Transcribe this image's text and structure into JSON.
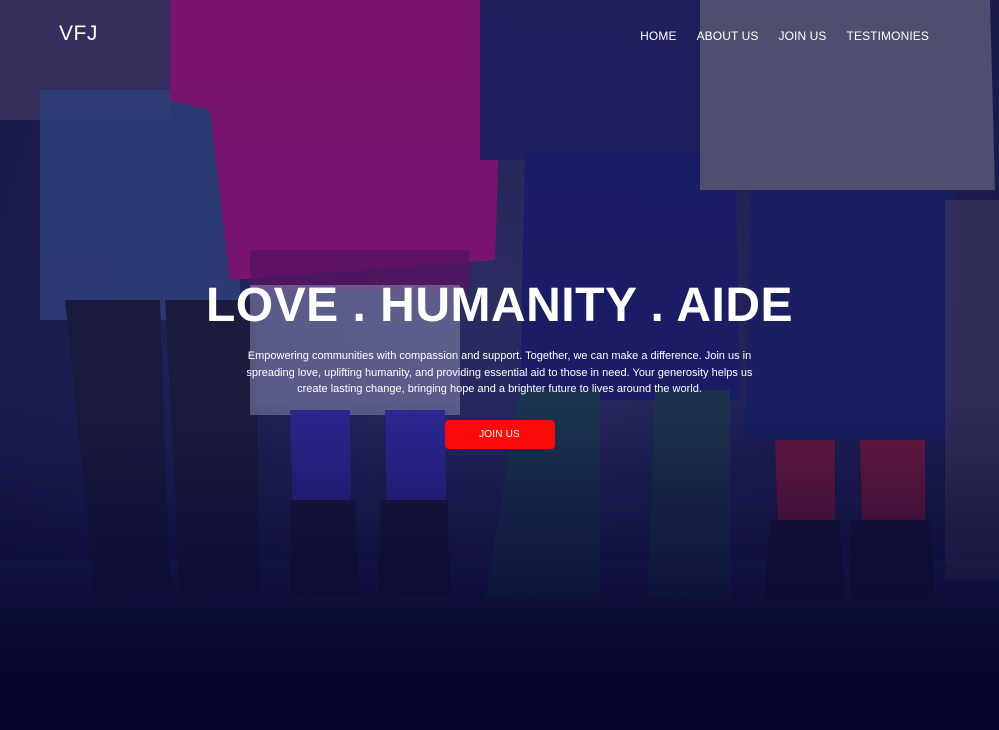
{
  "brand": {
    "logo_text": "VFJ"
  },
  "nav": {
    "items": [
      {
        "label": "HOME"
      },
      {
        "label": "ABOUT US"
      },
      {
        "label": "JOIN US"
      },
      {
        "label": "TESTIMONIES"
      }
    ]
  },
  "hero": {
    "title": "LOVE . HUMANITY . AIDE",
    "description": "Empowering communities with compassion and support. Together, we can make a difference. Join us in spreading love, uplifting humanity, and providing essential aid to those in need. Your generosity helps us create lasting change, bringing hope and a brighter future to lives around the world.",
    "cta_label": "JOIN US"
  },
  "colors": {
    "overlay": "#140f5a",
    "bottom": "#06062e",
    "cta": "#ff0a0a",
    "text": "#ffffff"
  }
}
